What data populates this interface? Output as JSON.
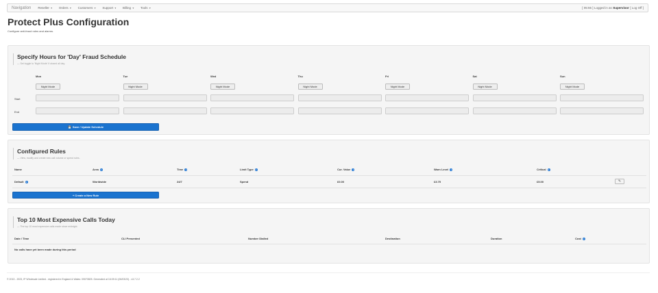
{
  "nav": {
    "brand": "Navigation",
    "items": [
      "Reseller",
      "Orders",
      "Customers",
      "Support",
      "Billing",
      "Tools"
    ],
    "time": "[ 05:55 ]",
    "logged_in_text": "Logged in as",
    "user": "Supervisor",
    "logoff": "[ Log Off ]"
  },
  "page": {
    "title": "Protect Plus Configuration",
    "subtitle": "Configure anti-fraud rules and alarms."
  },
  "schedule": {
    "title": "Specify Hours for 'Day' Fraud Schedule",
    "subtitle": "— Set toggle to 'Night Mode' if closed all day.",
    "days": [
      "Mon",
      "Tue",
      "Wed",
      "Thu",
      "Fri",
      "Sat",
      "Sun"
    ],
    "night_mode_label": "Night Mode",
    "start_label": "Start",
    "end_label": "End",
    "save_button": "Save / Update Schedule",
    "start_values": [
      "",
      "",
      "",
      "",
      "",
      "",
      ""
    ],
    "end_values": [
      "",
      "",
      "",
      "",
      "",
      "",
      ""
    ]
  },
  "rules": {
    "title": "Configured Rules",
    "subtitle": "— View, modify and create new call volume or spend rules.",
    "columns": [
      "Name",
      "Area",
      "Time",
      "Limit Type",
      "Cur. Value",
      "Warn Level",
      "Critical"
    ],
    "rows": [
      {
        "name": "Default",
        "area": "Worldwide",
        "time": "24/7",
        "limit_type": "Spend",
        "cur_value": "£0.00",
        "warn_level": "£3.75",
        "critical": "£5.00"
      }
    ],
    "create_button": "+ Create a New Rule"
  },
  "calls": {
    "title": "Top 10 Most Expensive Calls Today",
    "subtitle": "— The top 10 most expensive calls made since midnight.",
    "columns": [
      "Date / Time",
      "CLI Presented",
      "Number Dialled",
      "Destination",
      "Duration",
      "Cost"
    ],
    "empty_message": "No calls have yet been made during this period"
  },
  "footer": {
    "text": "© 2013 - 2023, IP Wholesale Limited - registered in England & Wales: 09070825. Generated at 16:09:11 (06/03/23) - v3.7.2.2"
  }
}
